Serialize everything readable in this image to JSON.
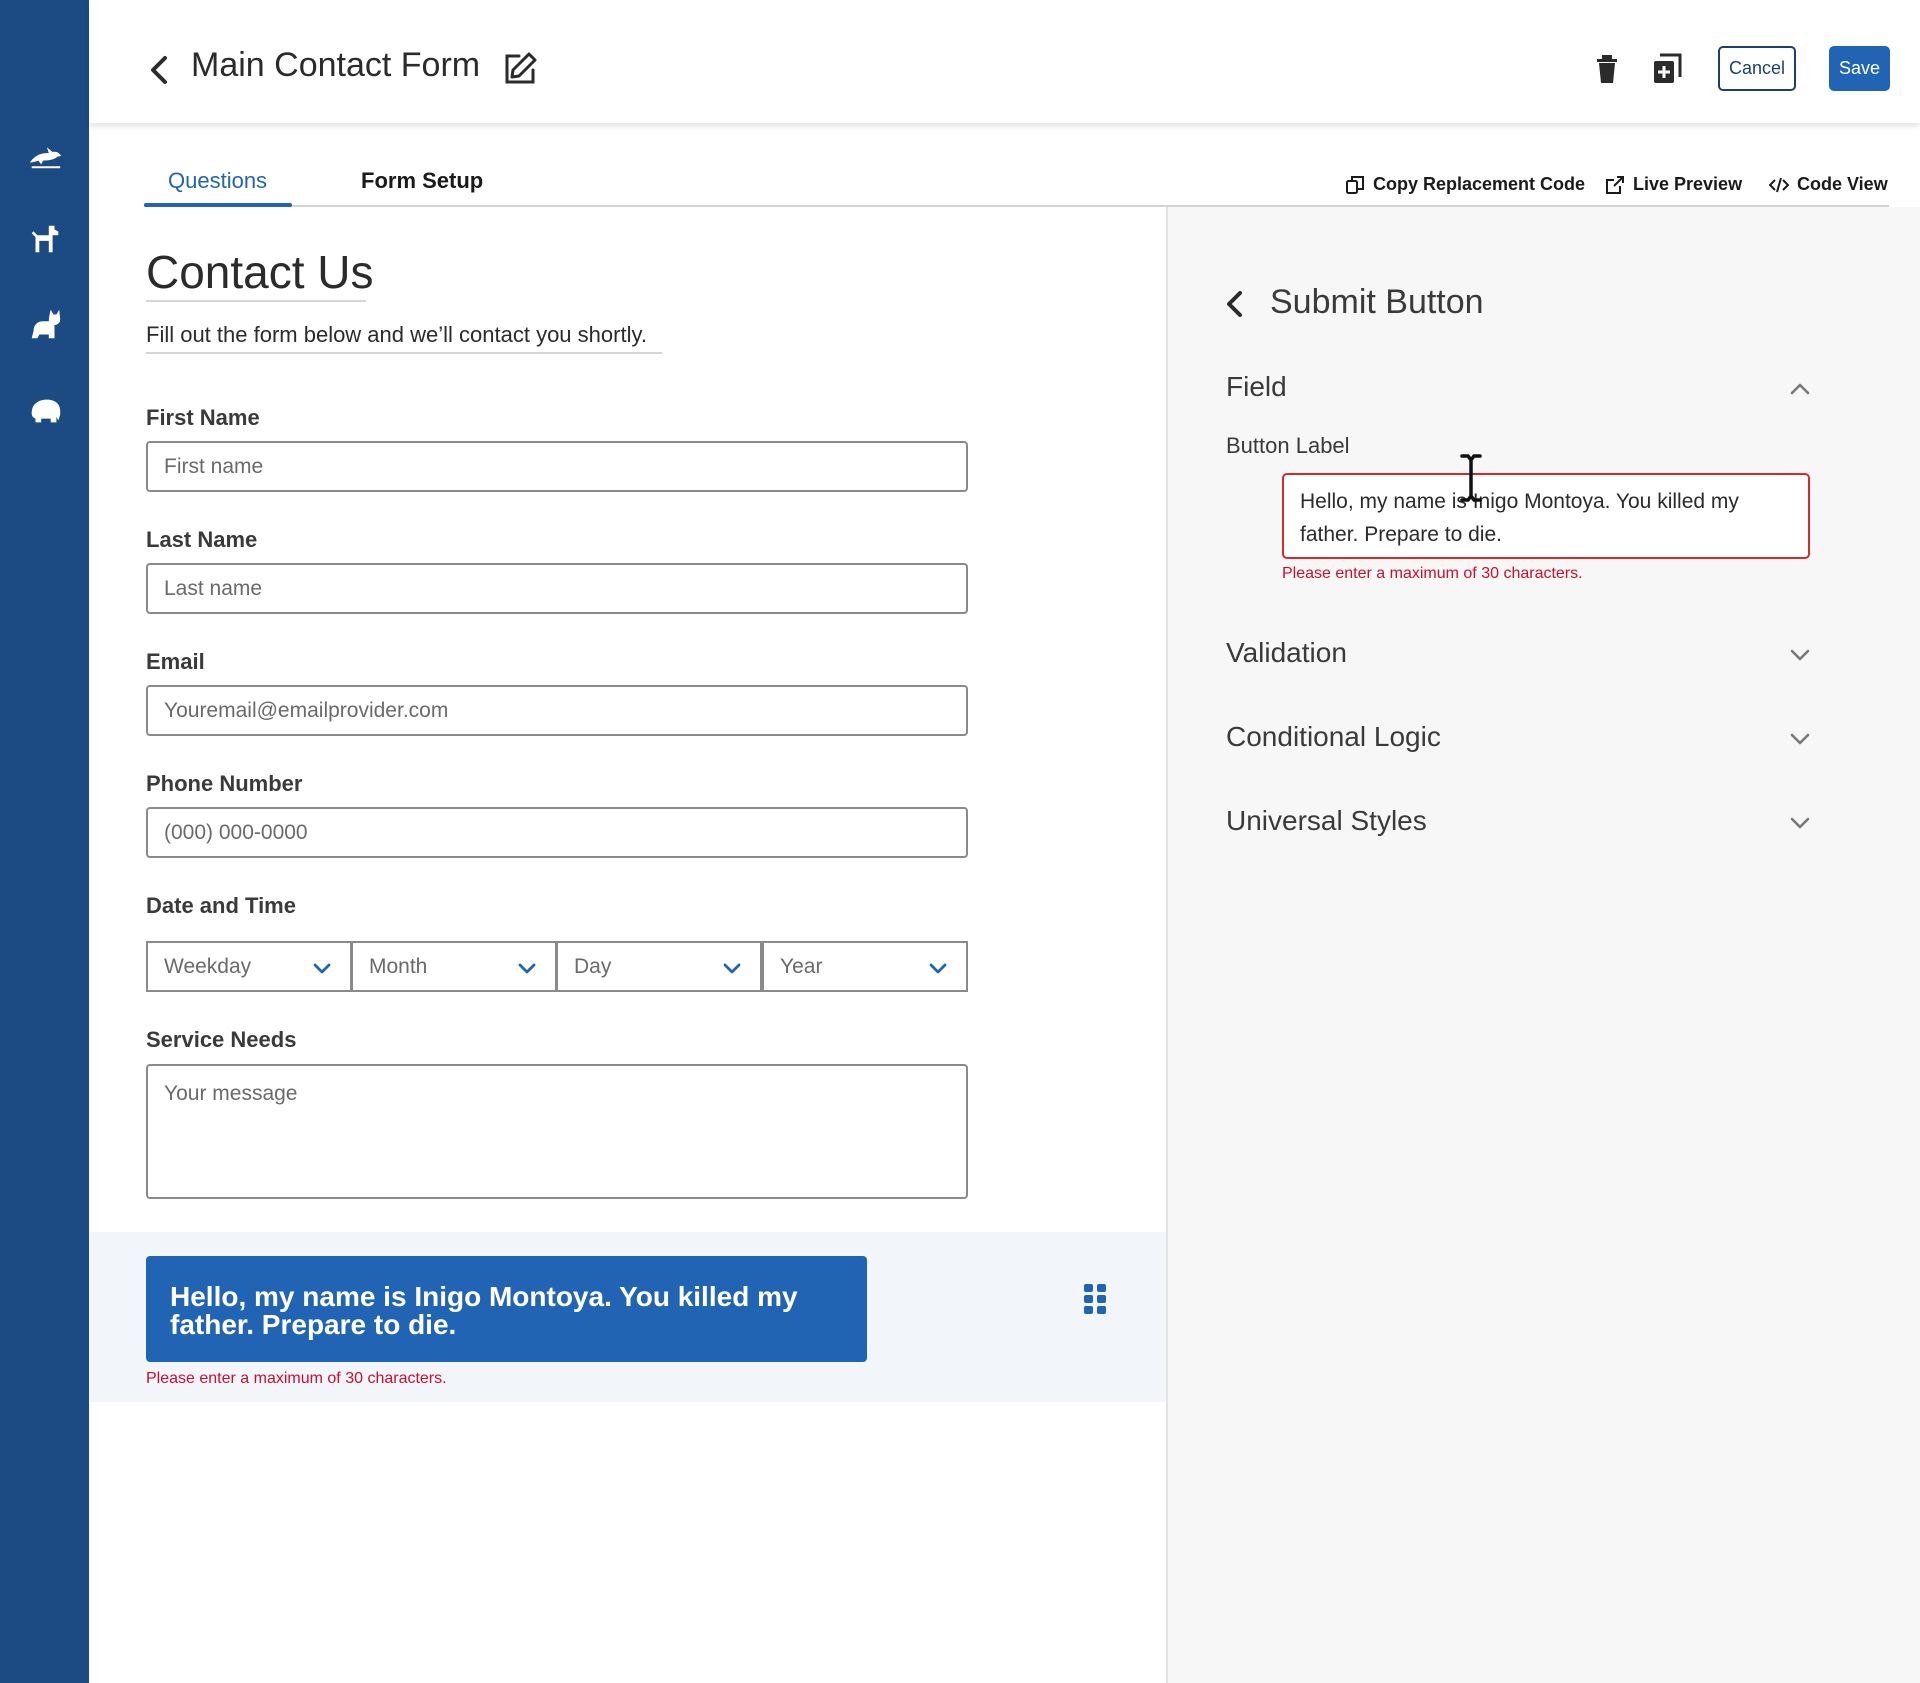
{
  "header": {
    "title": "Main Contact Form",
    "cancel_label": "Cancel",
    "save_label": "Save"
  },
  "tabs": {
    "questions": "Questions",
    "form_setup": "Form Setup"
  },
  "tools": {
    "copy_code": "Copy Replacement Code",
    "live_preview": "Live Preview",
    "code_view": "Code View"
  },
  "form": {
    "heading": "Contact Us",
    "subheading": "Fill out the form below and we’ll contact you shortly.",
    "first_name": {
      "label": "First Name",
      "placeholder": "First name"
    },
    "last_name": {
      "label": "Last Name",
      "placeholder": "Last name"
    },
    "email": {
      "label": "Email",
      "placeholder": "Youremail@emailprovider.com"
    },
    "phone": {
      "label": "Phone Number",
      "placeholder": "(000) 000-0000"
    },
    "date_time": {
      "label": "Date and Time",
      "weekday": "Weekday",
      "month": "Month",
      "day": "Day",
      "year": "Year"
    },
    "service_needs": {
      "label": "Service Needs",
      "placeholder": "Your message"
    },
    "submit": {
      "label": "Hello, my name is Inigo Montoya. You killed my father. Prepare to die.",
      "error": "Please enter a maximum of 30 characters."
    }
  },
  "panel": {
    "title": "Submit Button",
    "field_section": "Field",
    "button_label_label": "Button Label",
    "button_label_value": "Hello, my name is Inigo Montoya. You killed my father. Prepare to die.",
    "button_label_error": "Please enter a maximum of 30 characters.",
    "validation": "Validation",
    "conditional_logic": "Conditional Logic",
    "universal_styles": "Universal Styles"
  },
  "icons": {
    "rail": [
      "dolphin-icon",
      "dog-icon",
      "cat-icon",
      "elephant-icon"
    ],
    "header": [
      "back-arrow-icon",
      "edit-icon",
      "trash-icon",
      "duplicate-icon"
    ]
  },
  "colors": {
    "rail": "#1c4a82",
    "primary": "#2264b4",
    "error": "#c8102e"
  }
}
